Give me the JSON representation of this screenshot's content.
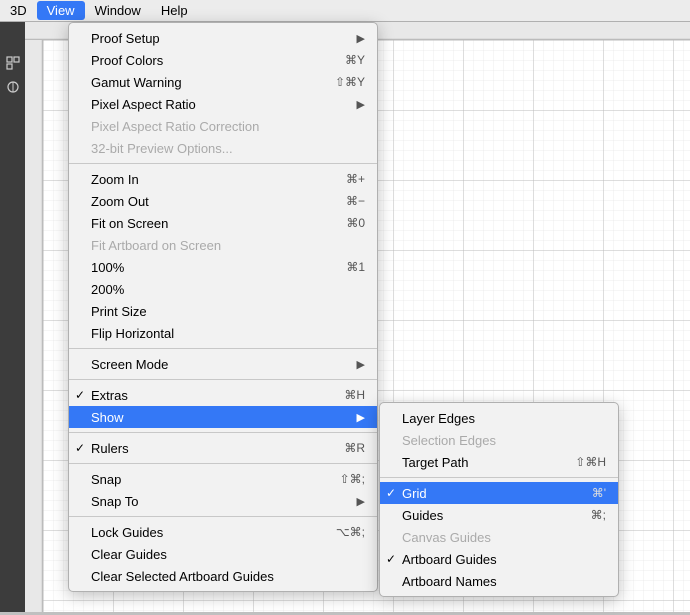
{
  "menubar": {
    "items": [
      {
        "label": "3D",
        "active": false
      },
      {
        "label": "View",
        "active": true
      },
      {
        "label": "Window",
        "active": false
      },
      {
        "label": "Help",
        "active": false
      }
    ]
  },
  "view_menu": {
    "items": [
      {
        "id": "proof-setup",
        "label": "Proof Setup",
        "shortcut": "",
        "arrow": true,
        "disabled": false,
        "check": false,
        "separator_above": false
      },
      {
        "id": "proof-colors",
        "label": "Proof Colors",
        "shortcut": "⌘Y",
        "arrow": false,
        "disabled": false,
        "check": false,
        "separator_above": false
      },
      {
        "id": "gamut-warning",
        "label": "Gamut Warning",
        "shortcut": "⇧⌘Y",
        "arrow": false,
        "disabled": false,
        "check": false,
        "separator_above": false
      },
      {
        "id": "pixel-aspect-ratio",
        "label": "Pixel Aspect Ratio",
        "shortcut": "",
        "arrow": true,
        "disabled": false,
        "check": false,
        "separator_above": false
      },
      {
        "id": "pixel-aspect-ratio-correction",
        "label": "Pixel Aspect Ratio Correction",
        "shortcut": "",
        "arrow": false,
        "disabled": true,
        "check": false,
        "separator_above": false
      },
      {
        "id": "32bit-preview",
        "label": "32-bit Preview Options...",
        "shortcut": "",
        "arrow": false,
        "disabled": true,
        "check": false,
        "separator_above": false
      },
      {
        "id": "zoom-in",
        "label": "Zoom In",
        "shortcut": "⌘+",
        "arrow": false,
        "disabled": false,
        "check": false,
        "separator_above": true
      },
      {
        "id": "zoom-out",
        "label": "Zoom Out",
        "shortcut": "⌘−",
        "arrow": false,
        "disabled": false,
        "check": false,
        "separator_above": false
      },
      {
        "id": "fit-on-screen",
        "label": "Fit on Screen",
        "shortcut": "⌘0",
        "arrow": false,
        "disabled": false,
        "check": false,
        "separator_above": false
      },
      {
        "id": "fit-artboard",
        "label": "Fit Artboard on Screen",
        "shortcut": "",
        "arrow": false,
        "disabled": true,
        "check": false,
        "separator_above": false
      },
      {
        "id": "100pct",
        "label": "100%",
        "shortcut": "⌘1",
        "arrow": false,
        "disabled": false,
        "check": false,
        "separator_above": false
      },
      {
        "id": "200pct",
        "label": "200%",
        "shortcut": "",
        "arrow": false,
        "disabled": false,
        "check": false,
        "separator_above": false
      },
      {
        "id": "print-size",
        "label": "Print Size",
        "shortcut": "",
        "arrow": false,
        "disabled": false,
        "check": false,
        "separator_above": false
      },
      {
        "id": "flip-horizontal",
        "label": "Flip Horizontal",
        "shortcut": "",
        "arrow": false,
        "disabled": false,
        "check": false,
        "separator_above": false
      },
      {
        "id": "screen-mode",
        "label": "Screen Mode",
        "shortcut": "",
        "arrow": true,
        "disabled": false,
        "check": false,
        "separator_above": true
      },
      {
        "id": "extras",
        "label": "Extras",
        "shortcut": "⌘H",
        "arrow": false,
        "disabled": false,
        "check": true,
        "separator_above": true
      },
      {
        "id": "show",
        "label": "Show",
        "shortcut": "",
        "arrow": true,
        "disabled": false,
        "check": false,
        "separator_above": false,
        "highlighted": true
      },
      {
        "id": "rulers",
        "label": "Rulers",
        "shortcut": "⌘R",
        "arrow": false,
        "disabled": false,
        "check": true,
        "separator_above": true
      },
      {
        "id": "snap",
        "label": "Snap",
        "shortcut": "⇧⌘;",
        "arrow": false,
        "disabled": false,
        "check": false,
        "separator_above": true
      },
      {
        "id": "snap-to",
        "label": "Snap To",
        "shortcut": "",
        "arrow": true,
        "disabled": false,
        "check": false,
        "separator_above": false
      },
      {
        "id": "lock-guides",
        "label": "Lock Guides",
        "shortcut": "⌥⌘;",
        "arrow": false,
        "disabled": false,
        "check": false,
        "separator_above": true
      },
      {
        "id": "clear-guides",
        "label": "Clear Guides",
        "shortcut": "",
        "arrow": false,
        "disabled": false,
        "check": false,
        "separator_above": false
      },
      {
        "id": "clear-selected-artboard-guides",
        "label": "Clear Selected Artboard Guides",
        "shortcut": "",
        "arrow": false,
        "disabled": false,
        "check": false,
        "separator_above": false
      }
    ]
  },
  "show_submenu": {
    "items": [
      {
        "id": "layer-edges",
        "label": "Layer Edges",
        "shortcut": "",
        "check": false,
        "disabled": false,
        "highlighted": false
      },
      {
        "id": "selection-edges",
        "label": "Selection Edges",
        "shortcut": "",
        "check": false,
        "disabled": false,
        "highlighted": false
      },
      {
        "id": "target-path",
        "label": "Target Path",
        "shortcut": "⇧⌘H",
        "check": false,
        "disabled": false,
        "highlighted": false
      },
      {
        "id": "grid",
        "label": "Grid",
        "shortcut": "⌘'",
        "check": true,
        "disabled": false,
        "highlighted": true
      },
      {
        "id": "guides",
        "label": "Guides",
        "shortcut": "⌘;",
        "check": false,
        "disabled": false,
        "highlighted": false
      },
      {
        "id": "canvas-guides",
        "label": "Canvas Guides",
        "shortcut": "",
        "check": false,
        "disabled": false,
        "highlighted": false
      },
      {
        "id": "artboard-guides",
        "label": "Artboard Guides",
        "shortcut": "",
        "check": true,
        "disabled": false,
        "highlighted": false
      },
      {
        "id": "artboard-names",
        "label": "Artboard Names",
        "shortcut": "",
        "check": false,
        "disabled": false,
        "highlighted": false
      }
    ]
  },
  "colors": {
    "highlight": "#3478f6",
    "menu_bg": "#f2f2f2",
    "disabled": "#aaa",
    "separator": "#c8c8c8"
  }
}
